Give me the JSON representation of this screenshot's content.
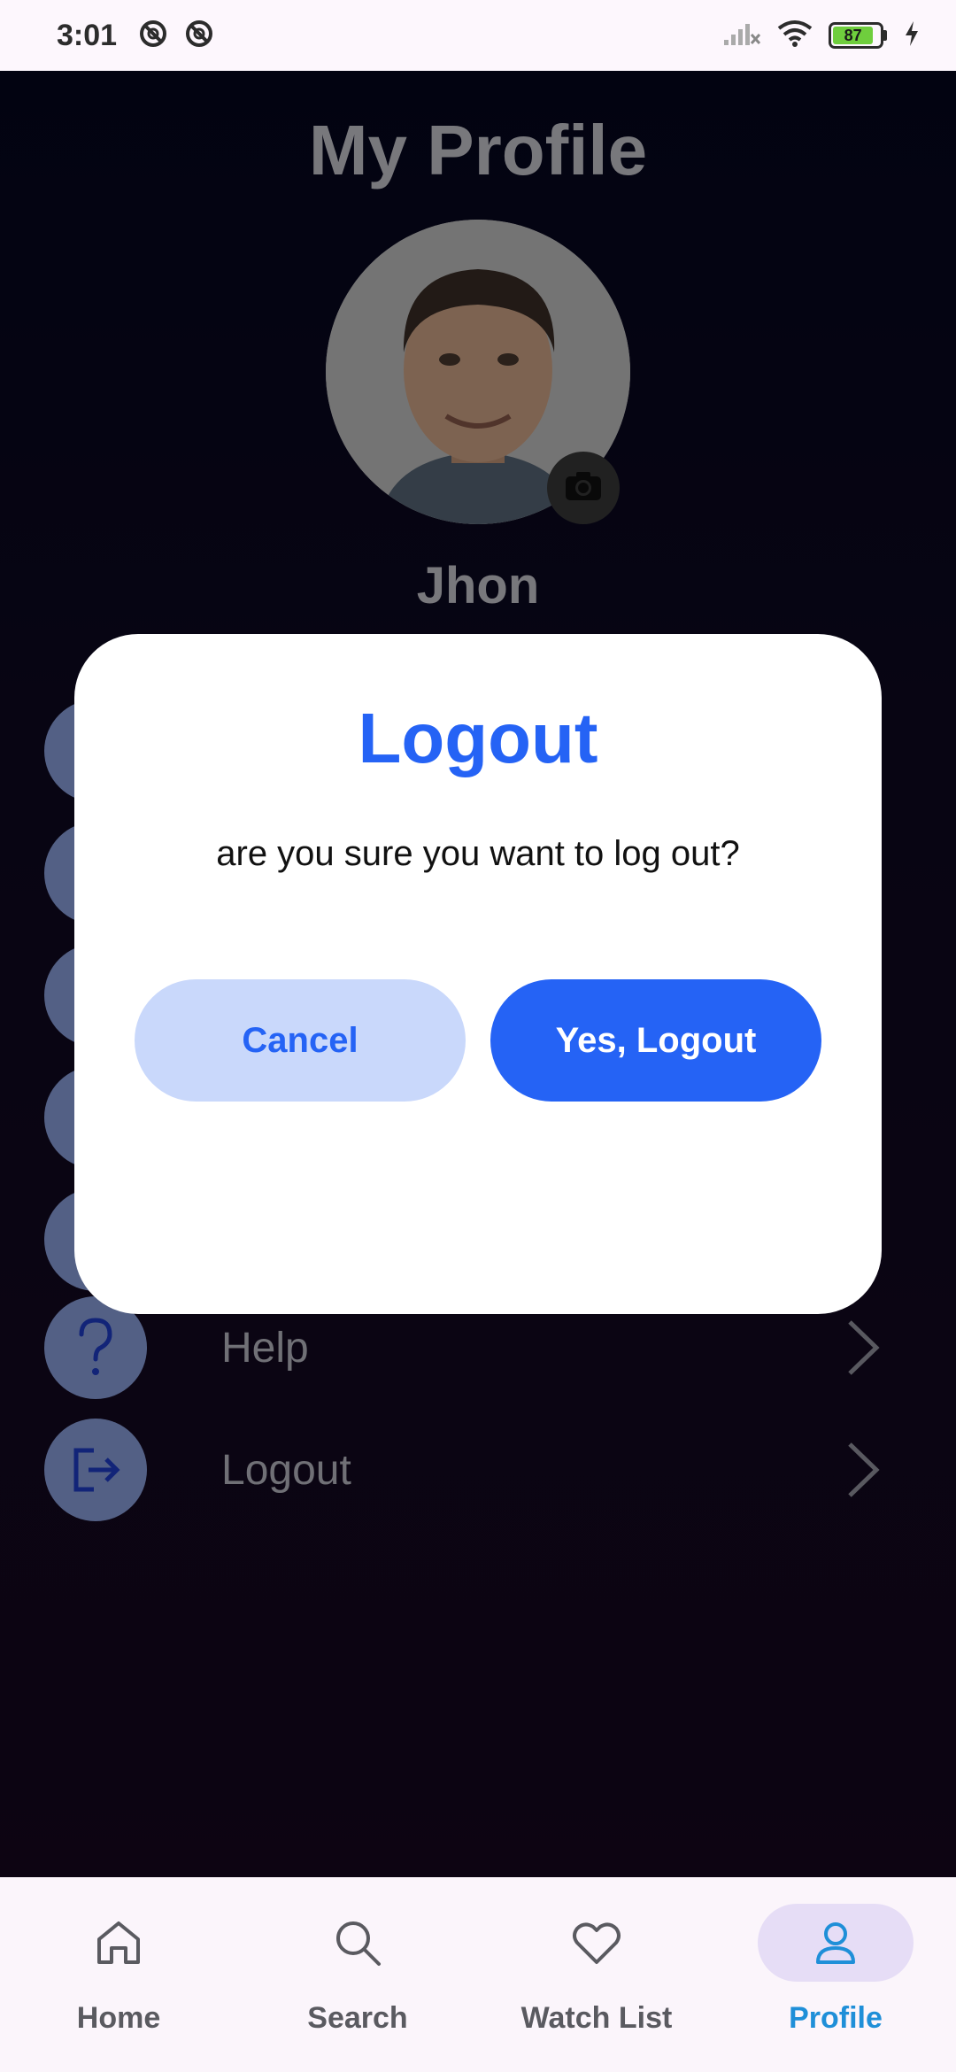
{
  "status_bar": {
    "time": "3:01",
    "battery_level": "87",
    "battery_color": "#6fce3d"
  },
  "profile": {
    "title": "My Profile",
    "user_name": "Jhon",
    "menu": [
      {
        "label": "",
        "icon": "person-icon"
      },
      {
        "label": "",
        "icon": "settings-icon"
      },
      {
        "label": "",
        "icon": "calendar-icon"
      },
      {
        "label": "",
        "icon": "card-icon"
      },
      {
        "label": "",
        "icon": "lock-icon"
      },
      {
        "label": "Help",
        "icon": "help-icon"
      },
      {
        "label": "Logout",
        "icon": "logout-icon"
      }
    ]
  },
  "dialog": {
    "title": "Logout",
    "message": "are you sure you want to log out?",
    "cancel_label": "Cancel",
    "confirm_label": "Yes, Logout",
    "accent_color": "#2563f5"
  },
  "bottom_nav": {
    "items": [
      {
        "label": "Home",
        "icon": "home-icon",
        "active": false
      },
      {
        "label": "Search",
        "icon": "search-icon",
        "active": false
      },
      {
        "label": "Watch List",
        "icon": "heart-icon",
        "active": false
      },
      {
        "label": "Profile",
        "icon": "user-icon",
        "active": true
      }
    ],
    "active_color": "#1f8fd8"
  }
}
